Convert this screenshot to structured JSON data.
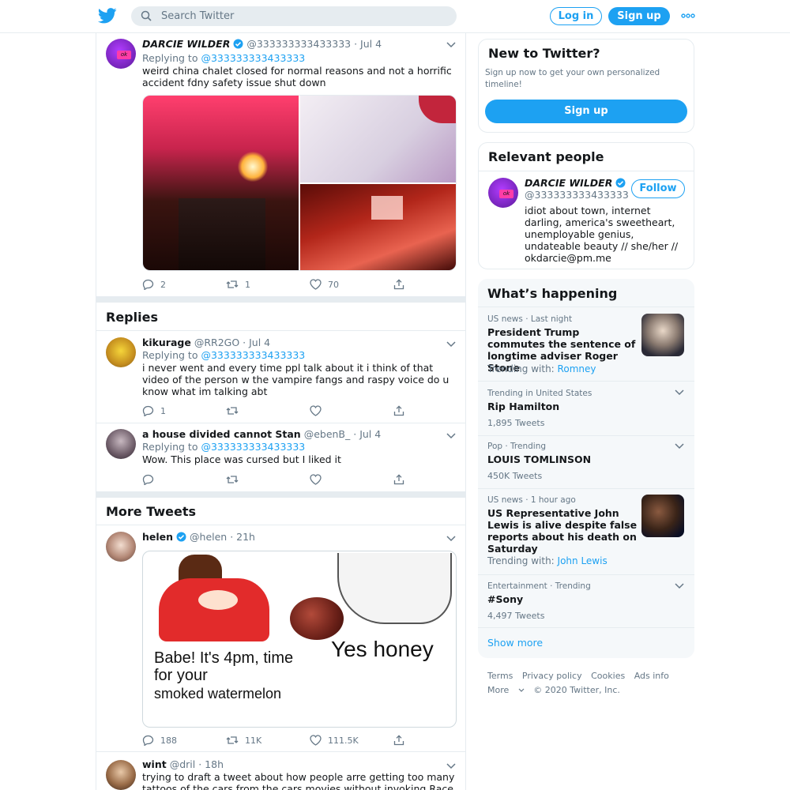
{
  "topbar": {
    "search_placeholder": "Search Twitter",
    "login_label": "Log in",
    "signup_label": "Sign up",
    "brand_color": "#1da1f2"
  },
  "main_tweet": {
    "name": "DARCIE WILDER",
    "handle": "@333333333433333",
    "date": "· Jul 4",
    "replying_label": "Replying to",
    "replying_to": "@333333333433333",
    "text": "weird china chalet closed for normal reasons and not a horrific accident fdny safety issue shut down",
    "replies": "2",
    "retweets": "1",
    "likes": "70",
    "avatar_text": "ok"
  },
  "replies_heading": "Replies",
  "replies": [
    {
      "name": "kikurage",
      "handle": "@RR2GO",
      "date": "· Jul 4",
      "replying_label": "Replying to",
      "replying_to": "@333333333433333",
      "text": "i never went and every time ppl talk about it i think of that video of the person w the vampire fangs and raspy voice do u know what im talking abt",
      "replies": "1"
    },
    {
      "name": "a house divided cannot Stan",
      "handle": "@ebenB_",
      "date": "· Jul 4",
      "replying_label": "Replying to",
      "replying_to": "@333333333433333",
      "text": "Wow. This place was cursed but I liked it"
    }
  ],
  "more_heading": "More Tweets",
  "more_tweets": [
    {
      "name": "helen",
      "handle": "@helen",
      "date": "· 21h",
      "meme_text_left": "Babe! It's 4pm, time for your",
      "meme_text_left2": "smoked watermelon",
      "meme_text_right": "Yes honey",
      "replies": "188",
      "retweets": "11K",
      "likes": "111.5K"
    },
    {
      "name": "wint",
      "handle": "@dril",
      "date": "· 18h",
      "text": "trying to draft a tweet about how people arre getting too many tattoos of the cars from the cars movies without invoking Race"
    }
  ],
  "new_to_twitter": {
    "title": "New to Twitter?",
    "desc": "Sign up now to get your own personalized timeline!",
    "button": "Sign up"
  },
  "relevant": {
    "title": "Relevant people",
    "name": "DARCIE WILDER",
    "handle": "@333333333433333",
    "follow": "Follow",
    "bio": "idiot about town, internet darling, america's sweetheart, unemployable genius, undateable beauty // she/her // okdarcie@pm.me"
  },
  "happening": {
    "title": "What’s happening",
    "items": [
      {
        "meta": "US news · Last night",
        "title": "President Trump commutes the sentence of longtime adviser Roger Stone",
        "sub_label": "Trending with:",
        "sub_link": "Romney"
      },
      {
        "meta": "Trending in United States",
        "title": "Rip Hamilton",
        "count": "1,895 Tweets"
      },
      {
        "meta": "Pop · Trending",
        "title": "LOUIS TOMLINSON",
        "count": "450K Tweets"
      },
      {
        "meta": "US news · 1 hour ago",
        "title": "US Representative John Lewis is alive despite false reports about his death on Saturday",
        "sub_label": "Trending with:",
        "sub_link": "John Lewis"
      },
      {
        "meta": "Entertainment · Trending",
        "title": "#Sony",
        "count": "4,497 Tweets"
      }
    ],
    "show_more": "Show more"
  },
  "footer": {
    "terms": "Terms",
    "privacy": "Privacy policy",
    "cookies": "Cookies",
    "ads": "Ads info",
    "more": "More",
    "copyright": "© 2020 Twitter, Inc."
  }
}
